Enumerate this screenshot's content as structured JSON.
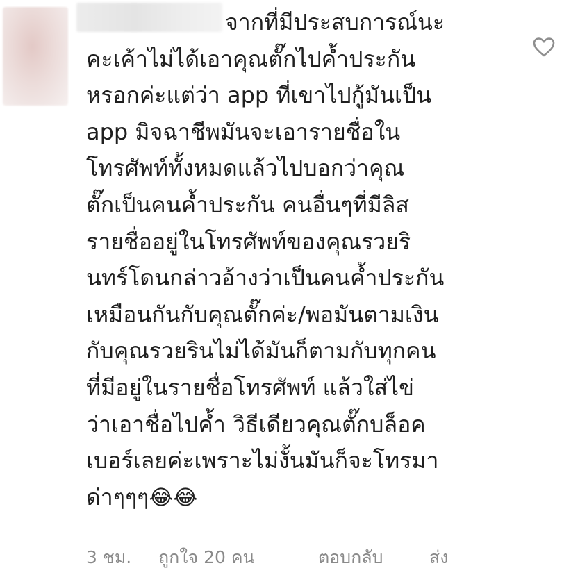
{
  "comment": {
    "lines": [
      "จากที่มีประสบการณ์นะ",
      "คะเค้าไม่ได้เอาคุณตั๊กไปค้ำประกัน",
      "หรอกค่ะแต่ว่า app ที่เขาไปกู้มันเป็น",
      "app มิจฉาชีพมันจะเอารายชื่อใน",
      "โทรศัพท์ทั้งหมดแล้วไปบอกว่าคุณ",
      "ตั๊กเป็นคนค้ำประกัน คนอื่นๆที่มีลิส",
      "รายชื่ออยู่ในโทรศัพท์ของคุณรวยริ",
      "นทร์โดนกล่าวอ้างว่าเป็นคนค้ำประกัน",
      "เหมือนกันกับคุณตั๊กค่ะ/พอมันตามเงิน",
      "กับคุณรวยรินไม่ได้มันก็ตามกับทุกคน",
      "ที่มีอยู่ในรายชื่อโทรศัพท์ แล้วใส่ไข่",
      "ว่าเอาชื่อไปค้ำ วิธีเดียวคุณตั๊กบล็อค",
      "เบอร์เลยค่ะเพราะไม่งั้นมันก็จะโทรมา",
      "ด่าๆๆๆ"
    ],
    "emoji": "😂😂"
  },
  "meta": {
    "time": "3 ชม.",
    "likes": "ถูกใจ 20 คน",
    "reply": "ตอบกลับ",
    "send": "ส่ง"
  },
  "icons": {
    "like": "heart-outline-icon"
  },
  "colors": {
    "text": "#1f1f1f",
    "meta": "#8a8a8a",
    "icon": "#8e8e8e"
  }
}
